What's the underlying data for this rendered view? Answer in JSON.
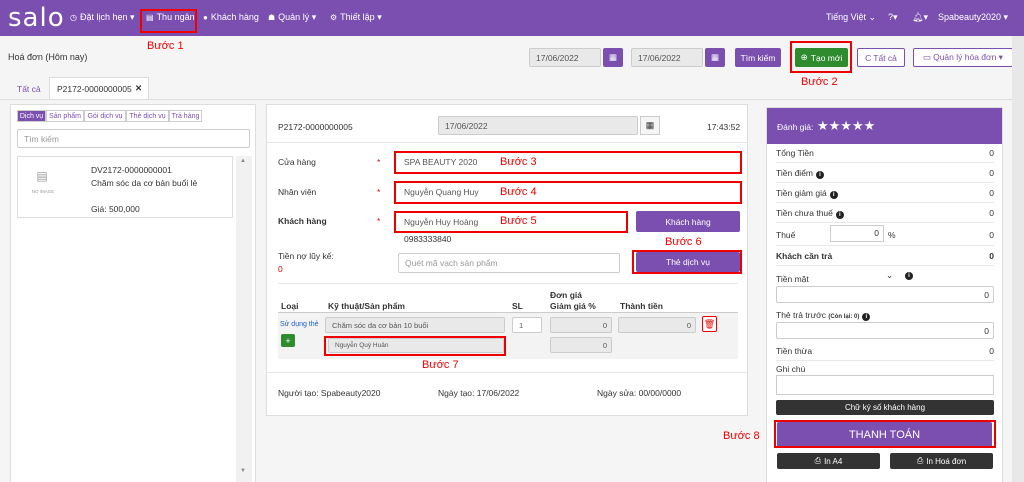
{
  "topbar": {
    "logo": "salo",
    "nav": [
      {
        "icon": "clock-icon",
        "label": "Đặt lịch hẹn ▾"
      },
      {
        "icon": "register-icon",
        "label": "Thu ngân"
      },
      {
        "icon": "user-icon",
        "label": "Khách hàng"
      },
      {
        "icon": "users-icon",
        "label": "Quản lý ▾"
      },
      {
        "icon": "cogs-icon",
        "label": "Thiết lập ▾"
      }
    ],
    "language": "Tiếng Việt",
    "help": "?▾",
    "bell": "▾",
    "account": "Spabeauty2020 ▾"
  },
  "header": {
    "title": "Hoá đơn (Hôm nay)",
    "date_from": "17/06/2022",
    "date_to": "17/06/2022",
    "search_btn": "Tìm kiếm",
    "create_btn": "Tạo mới",
    "all_btn": "Tất cả",
    "manage_btn": "Quản lý hóa đơn ▾"
  },
  "tabs": {
    "all": "Tất cả",
    "invoice": "P2172-0000000005",
    "close": "✕"
  },
  "left": {
    "subtabs": [
      "Dịch vụ",
      "Sản phẩm",
      "Gói dịch vụ",
      "Thẻ dịch vụ",
      "Trả hàng"
    ],
    "search_placeholder": "Tìm kiếm",
    "item": {
      "code": "DV2172-0000000001",
      "name": "Chăm sóc da cơ bản buổi lẻ",
      "price": "Giá: 500,000",
      "noimage": "NO IMAGE"
    }
  },
  "form": {
    "invoice_no": "P2172-0000000005",
    "date": "17/06/2022",
    "time": "17:43:52",
    "store_label": "Cửa hàng",
    "store_value": "SPA BEAUTY 2020",
    "staff_label": "Nhân viên",
    "staff_value": "Nguyễn Quang Huy",
    "customer_label": "Khách hàng",
    "customer_value": "Nguyễn Huy Hoàng",
    "customer_phone": "0983333840",
    "customer_btn": "Khách hàng",
    "debt_label": "Tiền nợ lũy kế:",
    "debt_value": "0",
    "barcode_placeholder": "Quét mã vạch sản phẩm",
    "card_btn": "Thẻ dịch vụ",
    "req": "*",
    "cols": {
      "type": "Loại",
      "tech": "Kỹ thuật/Sản phẩm",
      "qty": "SL",
      "price": "Đơn giá",
      "discount": "Giảm giá %",
      "total": "Thành tiền"
    },
    "row": {
      "type": "Sử dụng thẻ",
      "product": "Chăm sóc da cơ bản 10 buổi",
      "qty": "1",
      "price": "0",
      "total": "0",
      "tech": "Nguyễn Quý Huân",
      "discount": "0"
    },
    "creator": "Người tạo: Spabeauty2020",
    "created": "Ngày tạo: 17/06/2022",
    "modified": "Ngày sửa: 00/00/0000"
  },
  "summary": {
    "rating_label": "Đánh giá:",
    "stars": "★★★★★",
    "rows": [
      {
        "k": "Tổng Tiền",
        "v": "0"
      },
      {
        "k": "Tiền điểm",
        "v": "0"
      },
      {
        "k": "Tiền giảm giá",
        "v": "0"
      },
      {
        "k": "Tiền chưa thuế",
        "v": "0"
      }
    ],
    "tax_label": "Thuế",
    "tax_value": "0",
    "tax_unit": "%",
    "tax_amount": "0",
    "due_label": "Khách cần trả",
    "due_value": "0",
    "cash_label": "Tiền mặt",
    "cash_value": "0",
    "prepaid_label": "Thẻ trả trước",
    "prepaid_note": "(Còn lại: 0)",
    "prepaid_value": "0",
    "change_label": "Tiền thừa",
    "change_value": "0",
    "note_label": "Ghi chú",
    "sign_btn": "Chữ ký số khách hàng",
    "pay_btn": "THANH TOÁN",
    "print_a4": "In A4",
    "print_invoice": "In Hoá đơn"
  },
  "steps": [
    "Bước 1",
    "Bước 2",
    "Bước 3",
    "Bước 4",
    "Bước 5",
    "Bước 6",
    "Bước 7",
    "Bước 8"
  ],
  "colors": {
    "brand": "#7b4fb0",
    "highlight": "#e00000",
    "create": "#2e8b2e"
  }
}
